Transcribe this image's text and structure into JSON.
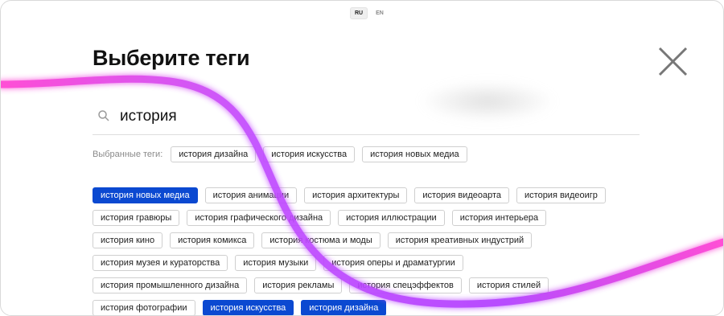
{
  "language": {
    "options": [
      "RU",
      "EN"
    ],
    "active": "RU"
  },
  "header": {
    "title": "Выберите теги"
  },
  "search": {
    "value": "история",
    "placeholder": ""
  },
  "selected": {
    "label": "Выбранные теги:",
    "tags": [
      "история дизайна",
      "история искусства",
      "история новых медиа"
    ]
  },
  "results": {
    "tags": [
      {
        "label": "история новых медиа",
        "selected": true
      },
      {
        "label": "история анимации",
        "selected": false
      },
      {
        "label": "история архитектуры",
        "selected": false
      },
      {
        "label": "история видеоарта",
        "selected": false
      },
      {
        "label": "история видеоигр",
        "selected": false
      },
      {
        "label": "история гравюры",
        "selected": false
      },
      {
        "label": "история графического дизайна",
        "selected": false
      },
      {
        "label": "история иллюстрации",
        "selected": false
      },
      {
        "label": "история интерьера",
        "selected": false
      },
      {
        "label": "история кино",
        "selected": false
      },
      {
        "label": "история комикса",
        "selected": false
      },
      {
        "label": "история костюма и моды",
        "selected": false
      },
      {
        "label": "история креативных индустрий",
        "selected": false
      },
      {
        "label": "история музея и кураторства",
        "selected": false
      },
      {
        "label": "история музыки",
        "selected": false
      },
      {
        "label": "история оперы и драматургии",
        "selected": false
      },
      {
        "label": "история промышленного дизайна",
        "selected": false
      },
      {
        "label": "история рекламы",
        "selected": false
      },
      {
        "label": "история спецэффектов",
        "selected": false
      },
      {
        "label": "история стилей",
        "selected": false
      },
      {
        "label": "история фотографии",
        "selected": false
      },
      {
        "label": "история искусства",
        "selected": true
      },
      {
        "label": "история дизайна",
        "selected": true
      }
    ]
  },
  "icons": {
    "search": "search-icon",
    "close": "close-icon"
  },
  "colors": {
    "accent": "#0b49d1",
    "stroke_start": "#ff3fd2",
    "stroke_end": "#a43bff"
  }
}
